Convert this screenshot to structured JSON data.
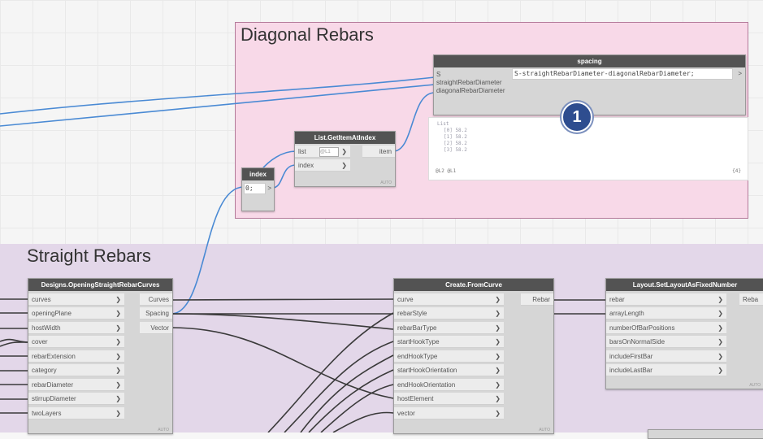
{
  "groups": {
    "diagonal": {
      "title": "Diagonal Rebars"
    },
    "straight": {
      "title": "Straight Rebars"
    }
  },
  "nodes": {
    "spacing": {
      "title": "spacing",
      "inputs": [
        "S",
        "straightRebarDiameter",
        "diagonalRebarDiameter"
      ],
      "code": "S-straightRebarDiameter-diagonalRebarDiameter;",
      "out_arrow": ">"
    },
    "get_item": {
      "title": "List.GetItemAtIndex",
      "inputs": [
        "list",
        "index"
      ],
      "list_level": "@L1",
      "output": "item",
      "foot": "AUTO"
    },
    "index": {
      "title": "index",
      "code": "0;",
      "out_arrow": ">"
    },
    "curves": {
      "title": "Designs.OpeningStraightRebarCurves",
      "inputs": [
        "curves",
        "openingPlane",
        "hostWidth",
        "cover",
        "rebarExtension",
        "category",
        "rebarDiameter",
        "stirrupDiameter",
        "twoLayers"
      ],
      "outputs": [
        "Curves",
        "Spacing",
        "Vector"
      ],
      "foot": "AUTO"
    },
    "from_curve": {
      "title": "Create.FromCurve",
      "inputs": [
        "curve",
        "rebarStyle",
        "rebarBarType",
        "startHookType",
        "endHookType",
        "startHookOrientation",
        "endHookOrientation",
        "hostElement",
        "vector"
      ],
      "outputs": [
        "Rebar"
      ],
      "foot": "AUTO"
    },
    "layout": {
      "title": "Layout.SetLayoutAsFixedNumber",
      "inputs": [
        "rebar",
        "arrayLength",
        "numberOfBarPositions",
        "barsOnNormalSide",
        "includeFirstBar",
        "includeLastBar"
      ],
      "outputs": [
        "Reba"
      ],
      "foot": "AUTO"
    }
  },
  "preview": {
    "lines": [
      "List",
      "[0] 58.2",
      "[1] 58.2",
      "[2] 58.2",
      "[3] 58.2"
    ],
    "footer_left": "@L2 @L1",
    "footer_right": "{4}"
  },
  "badge": {
    "label": "1"
  },
  "colors": {
    "wire_blue": "#4a8ad4",
    "wire_dark": "#3a3a3a",
    "node_header": "#535353",
    "group_pink": "#f8d9e8",
    "group_purple": "#e3d7e9",
    "badge": "#2e4d8f"
  }
}
